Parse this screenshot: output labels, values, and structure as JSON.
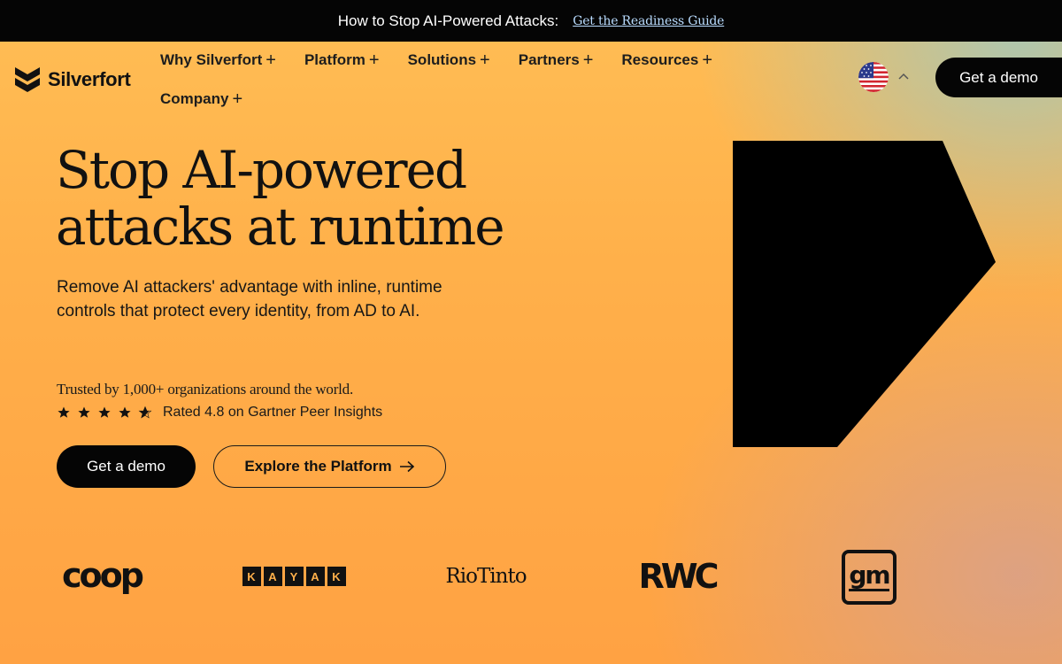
{
  "announcement": {
    "text": "How to Stop AI-Powered Attacks:",
    "link": "Get the Readiness Guide"
  },
  "brand": {
    "name": "Silverfort"
  },
  "nav": {
    "items": [
      {
        "label": "Why Silverfort"
      },
      {
        "label": "Platform"
      },
      {
        "label": "Solutions"
      },
      {
        "label": "Partners"
      },
      {
        "label": "Resources"
      },
      {
        "label": "Company"
      }
    ],
    "demo_label": "Get a demo"
  },
  "language": {
    "icon": "us-flag-icon"
  },
  "hero": {
    "title_line1": "Stop AI-powered",
    "title_line2": "attacks at runtime",
    "subtitle": "Remove AI attackers' advantage with inline, runtime controls that protect every identity, from AD to AI.",
    "trusted": "Trusted by 1,000+ organizations around the world.",
    "rating": {
      "stars": 4.8,
      "max": 5,
      "text": "Rated 4.8 on Gartner Peer Insights"
    },
    "cta_primary": "Get a demo",
    "cta_secondary": "Explore the Platform"
  },
  "customers": {
    "coop": "coop",
    "kayak": [
      "K",
      "A",
      "Y",
      "A",
      "K"
    ],
    "riotinto": "RioTinto",
    "rwc": "RWC",
    "gm": "gm"
  },
  "colors": {
    "bar_bg": "#050505",
    "link": "#b9dcff",
    "button_dark": "#050505",
    "hero_orange": "#ffb04a"
  }
}
